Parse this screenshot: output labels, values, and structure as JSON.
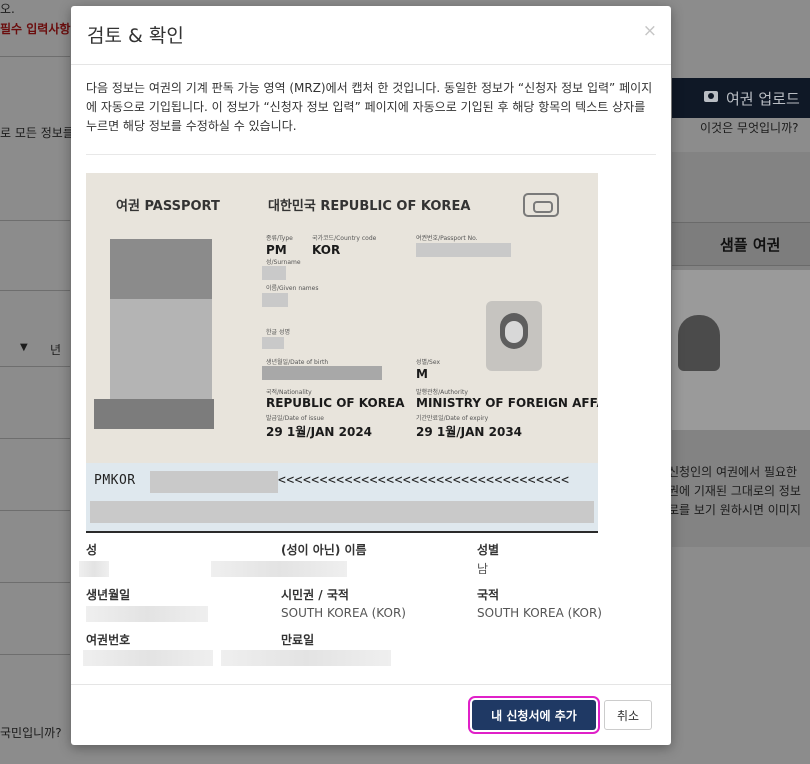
{
  "background": {
    "top_text": "오.",
    "required_text": "필수 입력사항",
    "left_text_1": "로 모든 정보를",
    "year_label": "년",
    "left_text_2": "국민입니까?",
    "upload_button": "여권 업로드",
    "what_is_this": "이것은 무엇입니까?",
    "sample_title": "샘플 여권",
    "sample_description_lines": [
      "신청인의 여권에서 필요한",
      "권에 기재된 그대로의 정보",
      "로를 보기 원하시면 이미지"
    ]
  },
  "modal": {
    "title": "검토 & 확인",
    "close": "×",
    "intro": "다음 정보는 여권의 기계 판독 가능 영역 (MRZ)에서 캡처 한 것입니다. 동일한 정보가 “신청자 정보 입력” 페이지에 자동으로 기입됩니다. 이 정보가 “신청자 정보 입력” 페이지에 자동으로 기입된 후 해당 항목의 텍스트 상자를 누르면 해당 정보를 수정하실 수 있습니다.",
    "passport": {
      "header_left": "여권 PASSPORT",
      "header_right": "대한민국 REPUBLIC OF KOREA",
      "type_label": "종류/Type",
      "country_label": "국가코드/Country code",
      "passport_no_label": "여권번호/Passport No.",
      "type_value": "PM",
      "country_value": "KOR",
      "surname_label": "성/Surname",
      "given_label": "이름/Given names",
      "korean_name_label": "한글 성명",
      "dob_label": "생년월일/Date of birth",
      "sex_label": "성별/Sex",
      "sex_value": "M",
      "nationality_label": "국적/Nationality",
      "nationality_value": "REPUBLIC OF KOREA",
      "authority_label": "발행관청/Authority",
      "authority_value": "MINISTRY OF FOREIGN AFFAIRS",
      "issue_label": "발급일/Date of issue",
      "issue_value": "29 1월/JAN 2024",
      "expiry_label": "기간만료일/Date of expiry",
      "expiry_value": "29 1월/JAN 2034",
      "mrz_prefix": "PMKOR",
      "mrz_fill": "<<<<<<<<<<<<<<<<<<<<<<<<<<<<<<<<<<<"
    },
    "fields": {
      "surname_label": "성",
      "given_name_label": "(성이 아닌) 이름",
      "sex_label": "성별",
      "sex_value": "남",
      "dob_label": "생년월일",
      "citizenship_label": "시민권 / 국적",
      "citizenship_value": "SOUTH KOREA (KOR)",
      "nationality_label": "국적",
      "nationality_value": "SOUTH KOREA (KOR)",
      "passport_no_label": "여권번호",
      "expiry_label": "만료일"
    },
    "buttons": {
      "add": "내 신청서에 추가",
      "cancel": "취소"
    }
  }
}
